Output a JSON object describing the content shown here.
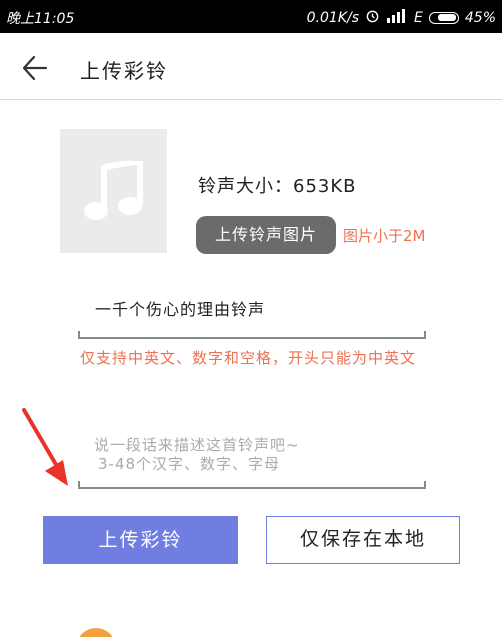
{
  "status_bar": {
    "time": "晚上11:05",
    "network_speed": "0.01K/s",
    "network_type": "E",
    "battery": "45%"
  },
  "header": {
    "title": "上传彩铃"
  },
  "ringtone": {
    "size_label": "铃声大小：653KB",
    "upload_image_label": "上传铃声图片",
    "image_hint": "图片小于2M"
  },
  "name_field": {
    "value": "一千个伤心的理由铃声",
    "hint": "仅支持中英文、数字和空格，开头只能为中英文"
  },
  "description_field": {
    "placeholder_line1": "说一段话来描述这首铃声吧~",
    "placeholder_line2": "3-48个汉字、数字、字母"
  },
  "actions": {
    "upload_label": "上传彩铃",
    "save_local_label": "仅保存在本地"
  },
  "colors": {
    "accent": "#6f7ee0",
    "hint": "#f07050",
    "arrow": "#e8332a"
  }
}
